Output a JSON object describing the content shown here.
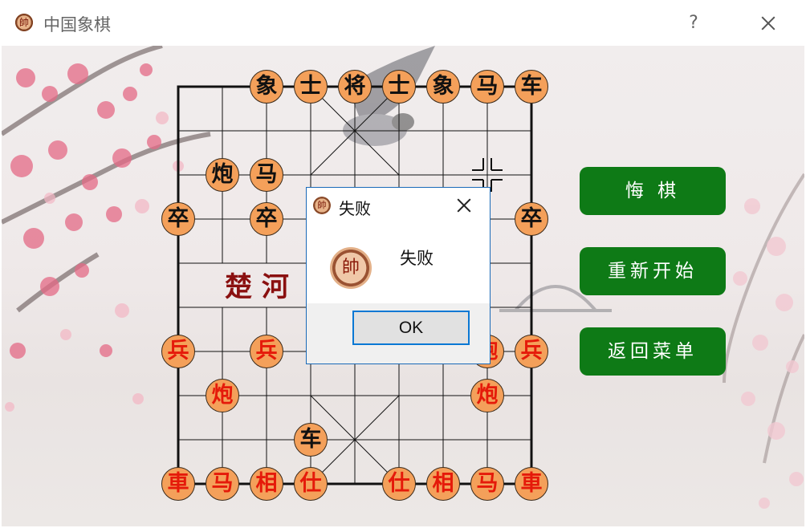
{
  "window": {
    "title": "中国象棋",
    "icon_char": "帥",
    "help_label": "?"
  },
  "board": {
    "river_left": "楚 河",
    "pieces": [
      {
        "char": "象",
        "color": "black",
        "col": 2,
        "row": 0
      },
      {
        "char": "士",
        "color": "black",
        "col": 3,
        "row": 0
      },
      {
        "char": "将",
        "color": "black",
        "col": 4,
        "row": 0
      },
      {
        "char": "士",
        "color": "black",
        "col": 5,
        "row": 0
      },
      {
        "char": "象",
        "color": "black",
        "col": 6,
        "row": 0
      },
      {
        "char": "马",
        "color": "black",
        "col": 7,
        "row": 0
      },
      {
        "char": "车",
        "color": "black",
        "col": 8,
        "row": 0
      },
      {
        "char": "炮",
        "color": "black",
        "col": 1,
        "row": 2
      },
      {
        "char": "马",
        "color": "black",
        "col": 2,
        "row": 2
      },
      {
        "char": "卒",
        "color": "black",
        "col": 0,
        "row": 3
      },
      {
        "char": "卒",
        "color": "black",
        "col": 2,
        "row": 3
      },
      {
        "char": "卒",
        "color": "black",
        "col": 8,
        "row": 3
      },
      {
        "char": "兵",
        "color": "red",
        "col": 0,
        "row": 6
      },
      {
        "char": "兵",
        "color": "red",
        "col": 2,
        "row": 6
      },
      {
        "char": "炮",
        "color": "red",
        "col": 7,
        "row": 6
      },
      {
        "char": "兵",
        "color": "red",
        "col": 8,
        "row": 6
      },
      {
        "char": "炮",
        "color": "red",
        "col": 1,
        "row": 7
      },
      {
        "char": "炮",
        "color": "red",
        "col": 7,
        "row": 7
      },
      {
        "char": "车",
        "color": "black",
        "col": 3,
        "row": 8
      },
      {
        "char": "車",
        "color": "red",
        "col": 0,
        "row": 9
      },
      {
        "char": "马",
        "color": "red",
        "col": 1,
        "row": 9
      },
      {
        "char": "相",
        "color": "red",
        "col": 2,
        "row": 9
      },
      {
        "char": "仕",
        "color": "red",
        "col": 3,
        "row": 9
      },
      {
        "char": "仕",
        "color": "red",
        "col": 5,
        "row": 9
      },
      {
        "char": "相",
        "color": "red",
        "col": 6,
        "row": 9
      },
      {
        "char": "马",
        "color": "red",
        "col": 7,
        "row": 9
      },
      {
        "char": "車",
        "color": "red",
        "col": 8,
        "row": 9
      }
    ]
  },
  "sidebar": {
    "undo_label": "悔  棋",
    "restart_label": "重新开始",
    "back_label": "返回菜单"
  },
  "dialog": {
    "title": "失败",
    "message": "失败",
    "ok_label": "OK",
    "badge_char": "帥"
  },
  "colors": {
    "button_green": "#0e7a16",
    "piece_fill": "#f4a05a",
    "red_piece": "#e51a0a",
    "dialog_border": "#1a6ab8"
  }
}
